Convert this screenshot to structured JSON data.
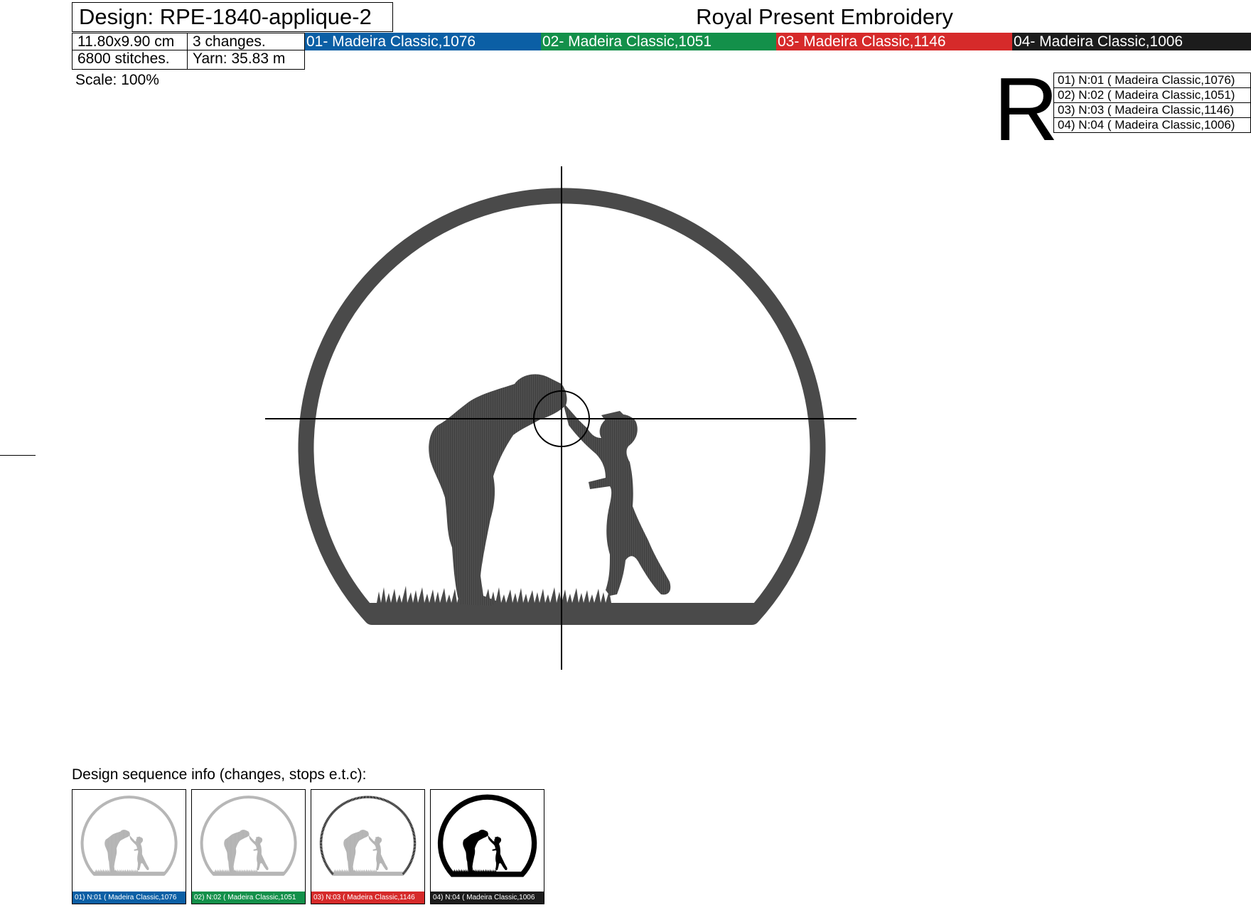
{
  "header": {
    "design_label": "Design: RPE-1840-applique-2",
    "brand": "Royal Present Embroidery",
    "size": "11.80x9.90 cm",
    "changes": "3 changes.",
    "stitches": "6800 stitches.",
    "yarn": "Yarn: 35.83 m",
    "scale": "Scale: 100%"
  },
  "threads": [
    {
      "label": "01- Madeira Classic,1076",
      "color": "#0b5fa5"
    },
    {
      "label": "02- Madeira Classic,1051",
      "color": "#13904a"
    },
    {
      "label": "03- Madeira Classic,1146",
      "color": "#d62a2a"
    },
    {
      "label": "04- Madeira Classic,1006",
      "color": "#1c1c1c"
    }
  ],
  "legend": {
    "letter": "R",
    "rows": [
      "01) N:01 ( Madeira Classic,1076)",
      "02) N:02 ( Madeira Classic,1051)",
      "03) N:03 ( Madeira Classic,1146)",
      "04) N:04 ( Madeira Classic,1006)"
    ]
  },
  "sequence": {
    "title": "Design sequence info (changes, stops e.t.c):",
    "steps": [
      {
        "caption": "01) N:01 ( Madeira Classic,1076",
        "color": "#0b5fa5"
      },
      {
        "caption": "02) N:02 ( Madeira Classic,1051",
        "color": "#13904a"
      },
      {
        "caption": "03) N:03 ( Madeira Classic,1146",
        "color": "#d62a2a"
      },
      {
        "caption": "04) N:04 ( Madeira Classic,1006",
        "color": "#1c1c1c"
      }
    ]
  },
  "colors": {
    "stitch": "#4a4a4a",
    "placement": "#b8b8b8"
  }
}
